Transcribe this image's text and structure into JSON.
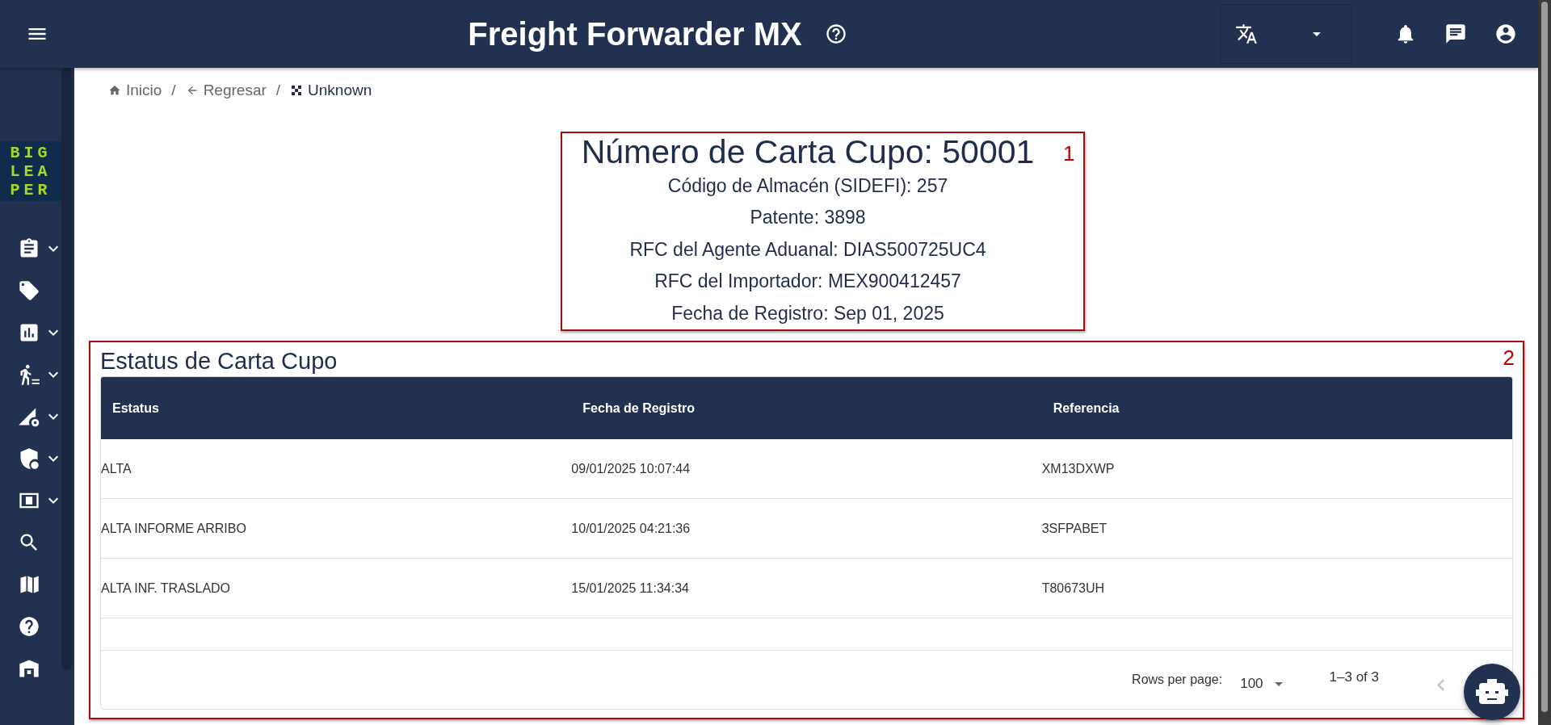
{
  "app_bar": {
    "title": "Freight Forwarder MX"
  },
  "sidebar": {
    "logo_lines": [
      "BIG",
      "LEA",
      "PER"
    ],
    "items": [
      {
        "kind": "clipboard",
        "expandable": true
      },
      {
        "kind": "tag",
        "expandable": false
      },
      {
        "kind": "chart",
        "expandable": true
      },
      {
        "kind": "walker",
        "expandable": true
      },
      {
        "kind": "triangle",
        "expandable": true
      },
      {
        "kind": "shield",
        "expandable": true
      },
      {
        "kind": "money",
        "expandable": true
      },
      {
        "kind": "search",
        "expandable": false
      },
      {
        "kind": "map",
        "expandable": false
      },
      {
        "kind": "help",
        "expandable": false
      },
      {
        "kind": "warehouse",
        "expandable": false
      }
    ]
  },
  "breadcrumb": {
    "separator": "/",
    "items": [
      {
        "kind": "home",
        "label": "Inicio"
      },
      {
        "kind": "back",
        "label": "Regresar"
      },
      {
        "kind": "current",
        "label": "Unknown"
      }
    ]
  },
  "summary": {
    "marker": "1",
    "title": "Número de Carta Cupo: 50001",
    "lines": [
      "Código de Almacén (SIDEFI): 257",
      "Patente: 3898",
      "RFC del Agente Aduanal: DIAS500725UC4",
      "RFC del Importador: MEX900412457",
      "Fecha de Registro: Sep 01, 2025"
    ]
  },
  "status": {
    "marker": "2",
    "title": "Estatus de Carta Cupo",
    "table": {
      "columns": [
        "Estatus",
        "Fecha de Registro",
        "Referencia"
      ],
      "rows": [
        [
          "ALTA",
          "09/01/2025 10:07:44",
          "XM13DXWP"
        ],
        [
          "ALTA INFORME ARRIBO",
          "10/01/2025 04:21:36",
          "3SFPABET"
        ],
        [
          "ALTA INF. TRASLADO",
          "15/01/2025 11:34:34",
          "T80673UH"
        ]
      ]
    },
    "pagination": {
      "rows_per_page_label": "Rows per page:",
      "rows_per_page": "100",
      "range": "1–3 of 3",
      "previous_disabled": true
    }
  }
}
